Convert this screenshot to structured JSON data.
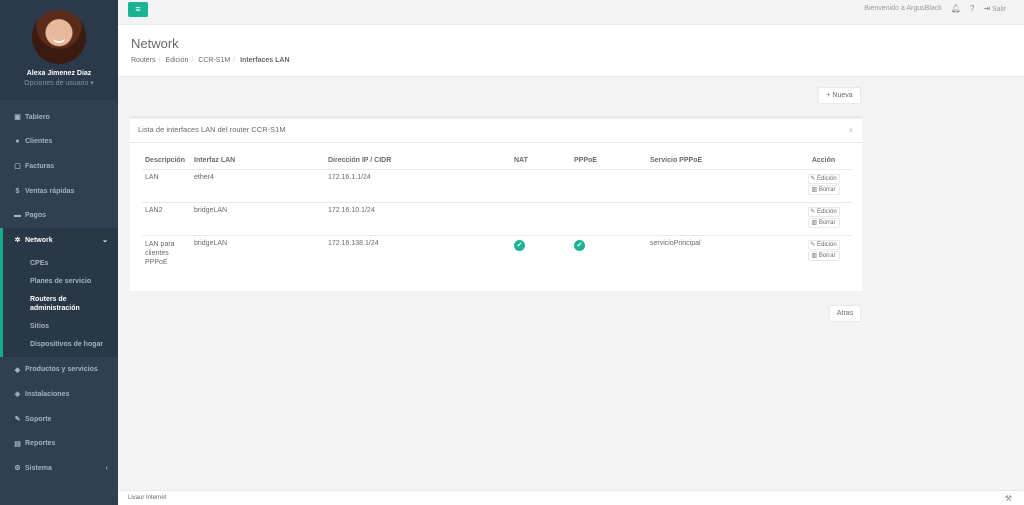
{
  "sidebar": {
    "user_name": "Alexa Jimenez Diaz",
    "user_options": "Opciones de usuario ▾",
    "items": [
      {
        "label": "Tablero",
        "icon": "dashboard-icon"
      },
      {
        "label": "Clientes",
        "icon": "users-icon"
      },
      {
        "label": "Facturas",
        "icon": "file-icon"
      },
      {
        "label": "Ventas rápidas",
        "icon": "dollar-icon"
      },
      {
        "label": "Pagos",
        "icon": "money-icon"
      },
      {
        "label": "Network",
        "icon": "snowflake-icon"
      },
      {
        "label": "Productos y servicios",
        "icon": "tag-icon"
      },
      {
        "label": "Instalaciones",
        "icon": "tags-icon"
      },
      {
        "label": "Soporte",
        "icon": "wrench-icon"
      },
      {
        "label": "Reportes",
        "icon": "book-icon"
      },
      {
        "label": "Sistema",
        "icon": "cogs-icon"
      }
    ],
    "network_sub": [
      "CPEs",
      "Planes de servicio",
      "Routers de administración",
      "Sitios",
      "Dispositivos de hogar"
    ]
  },
  "topbar": {
    "welcome": "Bienvenido a ArgusBlack",
    "logout": "Salir"
  },
  "heading": {
    "title": "Network",
    "breadcrumb": [
      "Routers",
      "Edición",
      "CCR-S1M",
      "Interfaces LAN"
    ]
  },
  "buttons": {
    "new": "+ Nueva",
    "back": "Atras",
    "edit": "Edición",
    "delete": "Borrar"
  },
  "panel": {
    "title": "Lista de interfaces LAN del router CCR-S1M",
    "columns": [
      "Descripción",
      "Interfaz LAN",
      "Dirección IP / CIDR",
      "NAT",
      "PPPoE",
      "Servicio PPPoE",
      "Acción"
    ],
    "rows": [
      {
        "descripcion": "LAN",
        "interfaz": "ether4",
        "ip": "172.16.1.1/24",
        "nat": false,
        "pppoe": false,
        "servicio": ""
      },
      {
        "descripcion": "LAN2",
        "interfaz": "bridgeLAN",
        "ip": "172.16.10.1/24",
        "nat": false,
        "pppoe": false,
        "servicio": ""
      },
      {
        "descripcion": "LAN para clientes PPPoE",
        "interfaz": "bridgeLAN",
        "ip": "172.16.138.1/24",
        "nat": true,
        "pppoe": true,
        "servicio": "servicioPrincipal"
      }
    ]
  },
  "footer": {
    "text": "Livaur Internet"
  },
  "colors": {
    "sidebar_bg": "#2f4050",
    "accent": "#1ab394"
  }
}
